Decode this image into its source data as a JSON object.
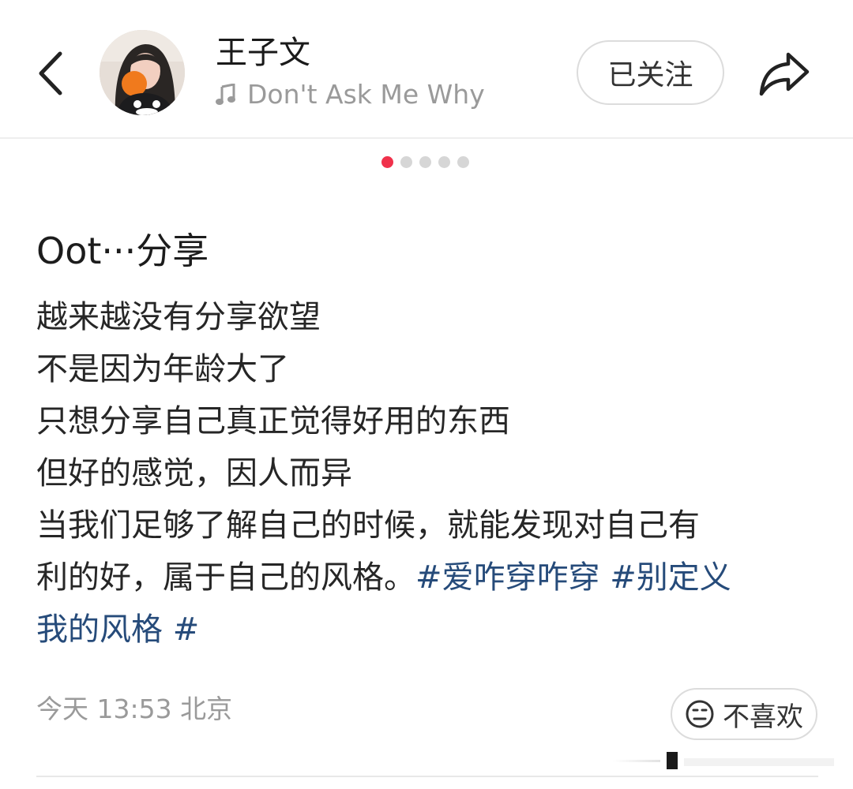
{
  "header": {
    "author_name": "王子文",
    "music_title": "Don't Ask Me Why",
    "follow_label": "已关注",
    "icons": {
      "back": "chevron-left-icon",
      "music": "music-note-icon",
      "share": "share-arrow-icon"
    }
  },
  "pager": {
    "total": 5,
    "active": 1,
    "active_color": "#f0314b"
  },
  "post": {
    "title": "Oot···分享",
    "lines": [
      "越来越没有分享欲望",
      "不是因为年龄大了",
      "只想分享自己真正觉得好用的东西",
      "但好的感觉，因人而异",
      "当我们足够了解自己的时候，就能发现对自己有",
      "利的好，属于自己的风格。"
    ],
    "tag_1_part_a": "#爱咋穿咋穿",
    "tag_2_part_a": "#别定义",
    "tag_2_part_b": "我的风格",
    "tag_2_end": "#",
    "tag_color": "#264b7a"
  },
  "meta": {
    "time_location": "今天 13:53 北京",
    "dislike_label": "不喜欢"
  }
}
